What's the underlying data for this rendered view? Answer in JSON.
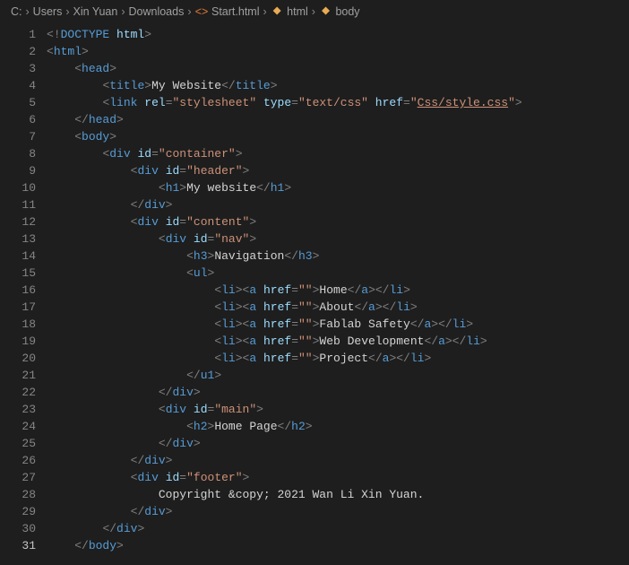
{
  "breadcrumb": [
    "C:",
    "Users",
    "Xin Yuan",
    "Downloads",
    "Start.html",
    "html",
    "body"
  ],
  "icons": {
    "file": "<>",
    "tag": "⬢",
    "brace": "{}"
  },
  "lines": [
    {
      "n": 1,
      "indent": 0,
      "seg": [
        [
          "p",
          "<!"
        ],
        [
          "kw",
          "DOCTYPE "
        ],
        [
          "a",
          "html"
        ],
        [
          "p",
          ">"
        ]
      ]
    },
    {
      "n": 2,
      "indent": 0,
      "seg": [
        [
          "p",
          "<"
        ],
        [
          "t",
          "html"
        ],
        [
          "p",
          ">"
        ]
      ]
    },
    {
      "n": 3,
      "indent": 1,
      "seg": [
        [
          "p",
          "<"
        ],
        [
          "t",
          "head"
        ],
        [
          "p",
          ">"
        ]
      ]
    },
    {
      "n": 4,
      "indent": 2,
      "seg": [
        [
          "p",
          "<"
        ],
        [
          "t",
          "title"
        ],
        [
          "p",
          ">"
        ],
        [
          "x",
          "My Website"
        ],
        [
          "p",
          "</"
        ],
        [
          "t",
          "title"
        ],
        [
          "p",
          ">"
        ]
      ]
    },
    {
      "n": 5,
      "indent": 2,
      "seg": [
        [
          "p",
          "<"
        ],
        [
          "t",
          "link"
        ],
        [
          "x",
          " "
        ],
        [
          "a",
          "rel"
        ],
        [
          "p",
          "="
        ],
        [
          "s",
          "\"stylesheet\""
        ],
        [
          "x",
          " "
        ],
        [
          "a",
          "type"
        ],
        [
          "p",
          "="
        ],
        [
          "s",
          "\"text/css\""
        ],
        [
          "x",
          " "
        ],
        [
          "a",
          "href"
        ],
        [
          "p",
          "="
        ],
        [
          "s",
          "\""
        ],
        [
          "su",
          "Css/style.css"
        ],
        [
          "s",
          "\""
        ],
        [
          "p",
          ">"
        ]
      ]
    },
    {
      "n": 6,
      "indent": 1,
      "seg": [
        [
          "p",
          "</"
        ],
        [
          "t",
          "head"
        ],
        [
          "p",
          ">"
        ]
      ]
    },
    {
      "n": 7,
      "indent": 1,
      "seg": [
        [
          "p",
          "<"
        ],
        [
          "t",
          "body"
        ],
        [
          "p",
          ">"
        ]
      ]
    },
    {
      "n": 8,
      "indent": 2,
      "seg": [
        [
          "p",
          "<"
        ],
        [
          "t",
          "div"
        ],
        [
          "x",
          " "
        ],
        [
          "a",
          "id"
        ],
        [
          "p",
          "="
        ],
        [
          "s",
          "\"container\""
        ],
        [
          "p",
          ">"
        ]
      ]
    },
    {
      "n": 9,
      "indent": 3,
      "seg": [
        [
          "p",
          "<"
        ],
        [
          "t",
          "div"
        ],
        [
          "x",
          " "
        ],
        [
          "a",
          "id"
        ],
        [
          "p",
          "="
        ],
        [
          "s",
          "\"header\""
        ],
        [
          "p",
          ">"
        ]
      ]
    },
    {
      "n": 10,
      "indent": 4,
      "seg": [
        [
          "p",
          "<"
        ],
        [
          "t",
          "h1"
        ],
        [
          "p",
          ">"
        ],
        [
          "x",
          "My website"
        ],
        [
          "p",
          "</"
        ],
        [
          "t",
          "h1"
        ],
        [
          "p",
          ">"
        ]
      ]
    },
    {
      "n": 11,
      "indent": 3,
      "seg": [
        [
          "p",
          "</"
        ],
        [
          "t",
          "div"
        ],
        [
          "p",
          ">"
        ]
      ]
    },
    {
      "n": 12,
      "indent": 3,
      "seg": [
        [
          "p",
          "<"
        ],
        [
          "t",
          "div"
        ],
        [
          "x",
          " "
        ],
        [
          "a",
          "id"
        ],
        [
          "p",
          "="
        ],
        [
          "s",
          "\"content\""
        ],
        [
          "p",
          ">"
        ]
      ]
    },
    {
      "n": 13,
      "indent": 4,
      "seg": [
        [
          "p",
          "<"
        ],
        [
          "t",
          "div"
        ],
        [
          "x",
          " "
        ],
        [
          "a",
          "id"
        ],
        [
          "p",
          "="
        ],
        [
          "s",
          "\"nav\""
        ],
        [
          "p",
          ">"
        ]
      ]
    },
    {
      "n": 14,
      "indent": 5,
      "seg": [
        [
          "p",
          "<"
        ],
        [
          "t",
          "h3"
        ],
        [
          "p",
          ">"
        ],
        [
          "x",
          "Navigation"
        ],
        [
          "p",
          "</"
        ],
        [
          "t",
          "h3"
        ],
        [
          "p",
          ">"
        ]
      ]
    },
    {
      "n": 15,
      "indent": 5,
      "seg": [
        [
          "p",
          "<"
        ],
        [
          "t",
          "ul"
        ],
        [
          "p",
          ">"
        ]
      ]
    },
    {
      "n": 16,
      "indent": 6,
      "seg": [
        [
          "p",
          "<"
        ],
        [
          "t",
          "li"
        ],
        [
          "p",
          "><"
        ],
        [
          "t",
          "a"
        ],
        [
          "x",
          " "
        ],
        [
          "a",
          "href"
        ],
        [
          "p",
          "="
        ],
        [
          "s",
          "\"\""
        ],
        [
          "p",
          ">"
        ],
        [
          "x",
          "Home"
        ],
        [
          "p",
          "</"
        ],
        [
          "t",
          "a"
        ],
        [
          "p",
          "></"
        ],
        [
          "t",
          "li"
        ],
        [
          "p",
          ">"
        ]
      ]
    },
    {
      "n": 17,
      "indent": 6,
      "seg": [
        [
          "p",
          "<"
        ],
        [
          "t",
          "li"
        ],
        [
          "p",
          "><"
        ],
        [
          "t",
          "a"
        ],
        [
          "x",
          " "
        ],
        [
          "a",
          "href"
        ],
        [
          "p",
          "="
        ],
        [
          "s",
          "\"\""
        ],
        [
          "p",
          ">"
        ],
        [
          "x",
          "About"
        ],
        [
          "p",
          "</"
        ],
        [
          "t",
          "a"
        ],
        [
          "p",
          "></"
        ],
        [
          "t",
          "li"
        ],
        [
          "p",
          ">"
        ]
      ]
    },
    {
      "n": 18,
      "indent": 6,
      "seg": [
        [
          "p",
          "<"
        ],
        [
          "t",
          "li"
        ],
        [
          "p",
          "><"
        ],
        [
          "t",
          "a"
        ],
        [
          "x",
          " "
        ],
        [
          "a",
          "href"
        ],
        [
          "p",
          "="
        ],
        [
          "s",
          "\"\""
        ],
        [
          "p",
          ">"
        ],
        [
          "x",
          "Fablab Safety"
        ],
        [
          "p",
          "</"
        ],
        [
          "t",
          "a"
        ],
        [
          "p",
          "></"
        ],
        [
          "t",
          "li"
        ],
        [
          "p",
          ">"
        ]
      ]
    },
    {
      "n": 19,
      "indent": 6,
      "seg": [
        [
          "p",
          "<"
        ],
        [
          "t",
          "li"
        ],
        [
          "p",
          "><"
        ],
        [
          "t",
          "a"
        ],
        [
          "x",
          " "
        ],
        [
          "a",
          "href"
        ],
        [
          "p",
          "="
        ],
        [
          "s",
          "\"\""
        ],
        [
          "p",
          ">"
        ],
        [
          "x",
          "Web Development"
        ],
        [
          "p",
          "</"
        ],
        [
          "t",
          "a"
        ],
        [
          "p",
          "></"
        ],
        [
          "t",
          "li"
        ],
        [
          "p",
          ">"
        ]
      ]
    },
    {
      "n": 20,
      "indent": 6,
      "seg": [
        [
          "p",
          "<"
        ],
        [
          "t",
          "li"
        ],
        [
          "p",
          "><"
        ],
        [
          "t",
          "a"
        ],
        [
          "x",
          " "
        ],
        [
          "a",
          "href"
        ],
        [
          "p",
          "="
        ],
        [
          "s",
          "\"\""
        ],
        [
          "p",
          ">"
        ],
        [
          "x",
          "Project"
        ],
        [
          "p",
          "</"
        ],
        [
          "t",
          "a"
        ],
        [
          "p",
          "></"
        ],
        [
          "t",
          "li"
        ],
        [
          "p",
          ">"
        ]
      ]
    },
    {
      "n": 21,
      "indent": 5,
      "seg": [
        [
          "p",
          "</"
        ],
        [
          "t",
          "u1"
        ],
        [
          "p",
          ">"
        ]
      ]
    },
    {
      "n": 22,
      "indent": 4,
      "seg": [
        [
          "p",
          "</"
        ],
        [
          "t",
          "div"
        ],
        [
          "p",
          ">"
        ]
      ]
    },
    {
      "n": 23,
      "indent": 4,
      "seg": [
        [
          "p",
          "<"
        ],
        [
          "t",
          "div"
        ],
        [
          "x",
          " "
        ],
        [
          "a",
          "id"
        ],
        [
          "p",
          "="
        ],
        [
          "s",
          "\"main\""
        ],
        [
          "p",
          ">"
        ]
      ]
    },
    {
      "n": 24,
      "indent": 5,
      "seg": [
        [
          "p",
          "<"
        ],
        [
          "t",
          "h2"
        ],
        [
          "p",
          ">"
        ],
        [
          "x",
          "Home Page"
        ],
        [
          "p",
          "</"
        ],
        [
          "t",
          "h2"
        ],
        [
          "p",
          ">"
        ]
      ]
    },
    {
      "n": 25,
      "indent": 4,
      "seg": [
        [
          "p",
          "</"
        ],
        [
          "t",
          "div"
        ],
        [
          "p",
          ">"
        ]
      ]
    },
    {
      "n": 26,
      "indent": 3,
      "seg": [
        [
          "p",
          "</"
        ],
        [
          "t",
          "div"
        ],
        [
          "p",
          ">"
        ]
      ]
    },
    {
      "n": 27,
      "indent": 3,
      "seg": [
        [
          "p",
          "<"
        ],
        [
          "t",
          "div"
        ],
        [
          "x",
          " "
        ],
        [
          "a",
          "id"
        ],
        [
          "p",
          "="
        ],
        [
          "s",
          "\"footer\""
        ],
        [
          "p",
          ">"
        ]
      ]
    },
    {
      "n": 28,
      "indent": 4,
      "seg": [
        [
          "x",
          "Copyright &copy; 2021 Wan Li Xin Yuan."
        ]
      ]
    },
    {
      "n": 29,
      "indent": 3,
      "seg": [
        [
          "p",
          "</"
        ],
        [
          "t",
          "div"
        ],
        [
          "p",
          ">"
        ]
      ]
    },
    {
      "n": 30,
      "indent": 2,
      "seg": [
        [
          "p",
          "</"
        ],
        [
          "t",
          "div"
        ],
        [
          "p",
          ">"
        ]
      ]
    },
    {
      "n": 31,
      "indent": 1,
      "seg": [
        [
          "p",
          "</"
        ],
        [
          "t",
          "body"
        ],
        [
          "p",
          ">"
        ]
      ]
    }
  ],
  "current_line": 31
}
